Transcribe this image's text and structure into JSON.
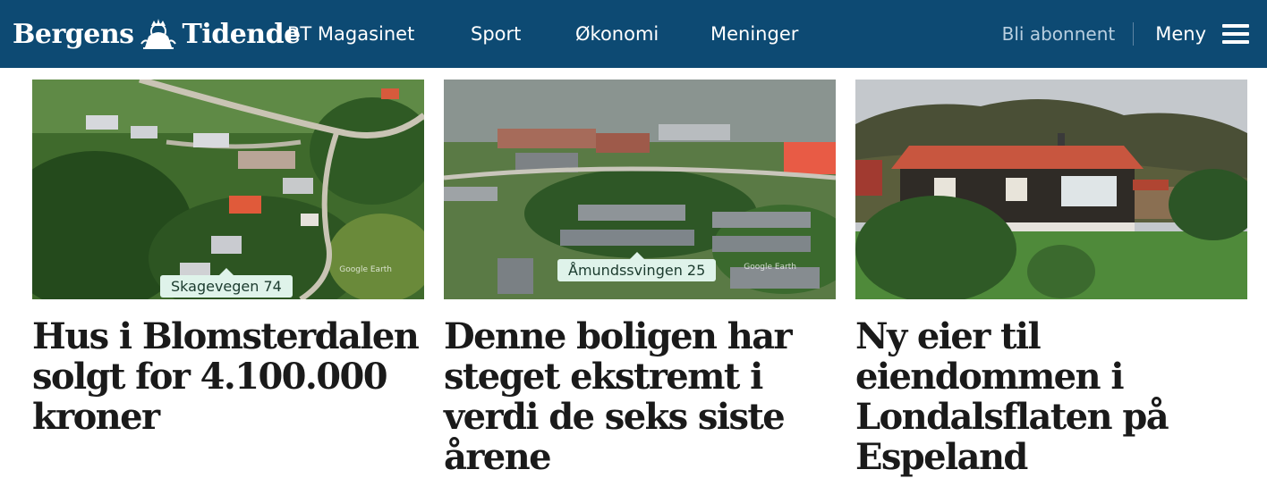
{
  "brand": {
    "name_left": "Bergens",
    "name_right": "Tidende"
  },
  "nav": {
    "items": [
      {
        "label": "BT Magasinet"
      },
      {
        "label": "Sport"
      },
      {
        "label": "Økonomi"
      },
      {
        "label": "Meninger"
      }
    ],
    "subscribe_label": "Bli abonnent",
    "menu_label": "Meny"
  },
  "articles": [
    {
      "location_label": "Skagevegen 74",
      "watermark": "Google Earth",
      "headline": "Hus i Blomsterdalen solgt for 4.100.000 kroner"
    },
    {
      "location_label": "Åmundssvingen 25",
      "watermark": "Google Earth",
      "headline": "Denne boligen har steget ekstremt i verdi de seks siste årene"
    },
    {
      "headline": "Ny eier til eiendommen i Londalsflaten på Espeland"
    }
  ],
  "colors": {
    "header_bg": "#0d4a73",
    "subscribe_text": "#b8cfe0",
    "headline_text": "#1a1a1a",
    "label_pill": "#dff3ea"
  }
}
